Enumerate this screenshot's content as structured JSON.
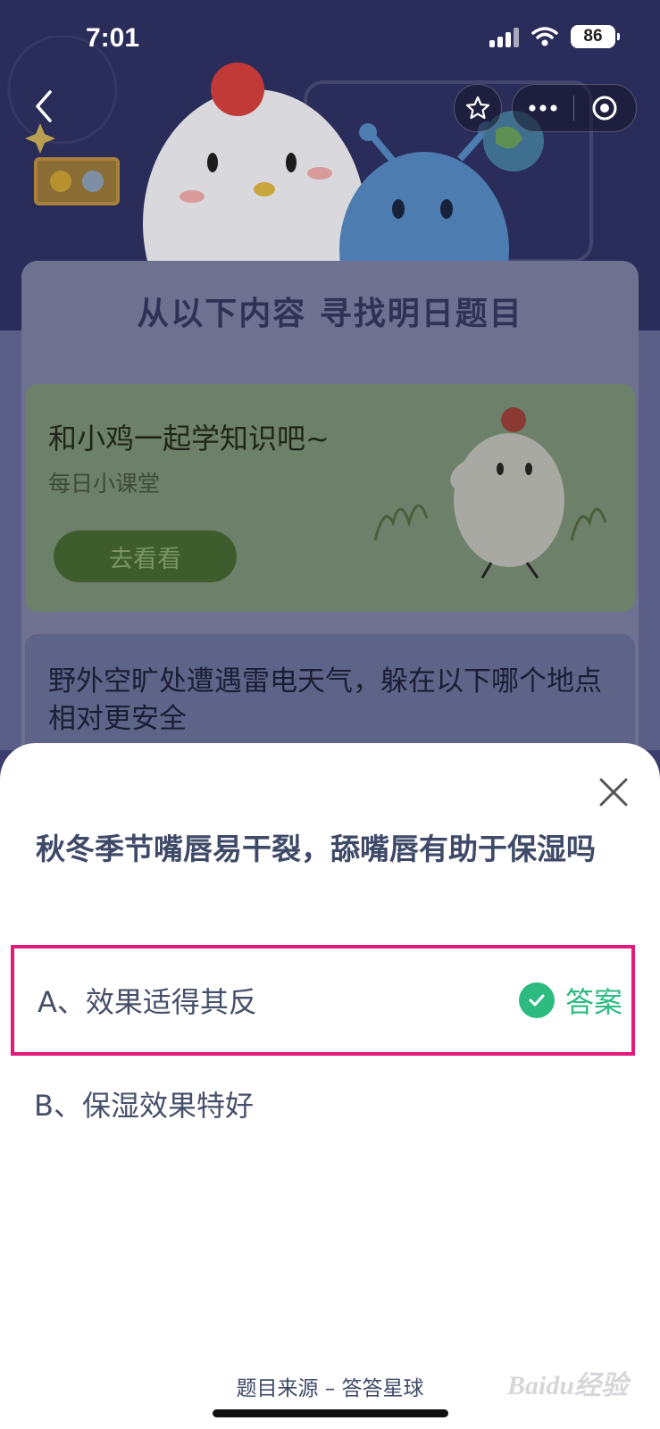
{
  "status_bar": {
    "time": "7:01",
    "battery": "86"
  },
  "banner": {
    "title": "从以下内容 寻找明日题目"
  },
  "lesson_card": {
    "title": "和小鸡一起学知识吧~",
    "subtitle": "每日小课堂",
    "button": "去看看"
  },
  "background_question": {
    "text": "野外空旷处遭遇雷电天气，躲在以下哪个地点相对更安全"
  },
  "sheet": {
    "question": "秋冬季节嘴唇易干裂，舔嘴唇有助于保湿吗",
    "options": [
      {
        "label": "A、效果适得其反",
        "is_answer": true,
        "answer_tag": "答案"
      },
      {
        "label": "B、保湿效果特好",
        "is_answer": false
      }
    ],
    "source": "题目来源 – 答答星球"
  },
  "watermark": "Baidu经验",
  "colors": {
    "accent_green": "#2dbb82",
    "highlight_border": "#e3197c",
    "question_text": "#3e4a68"
  },
  "icons": [
    "back-icon",
    "star-icon",
    "more-icon",
    "target-icon",
    "close-icon",
    "check-icon"
  ]
}
